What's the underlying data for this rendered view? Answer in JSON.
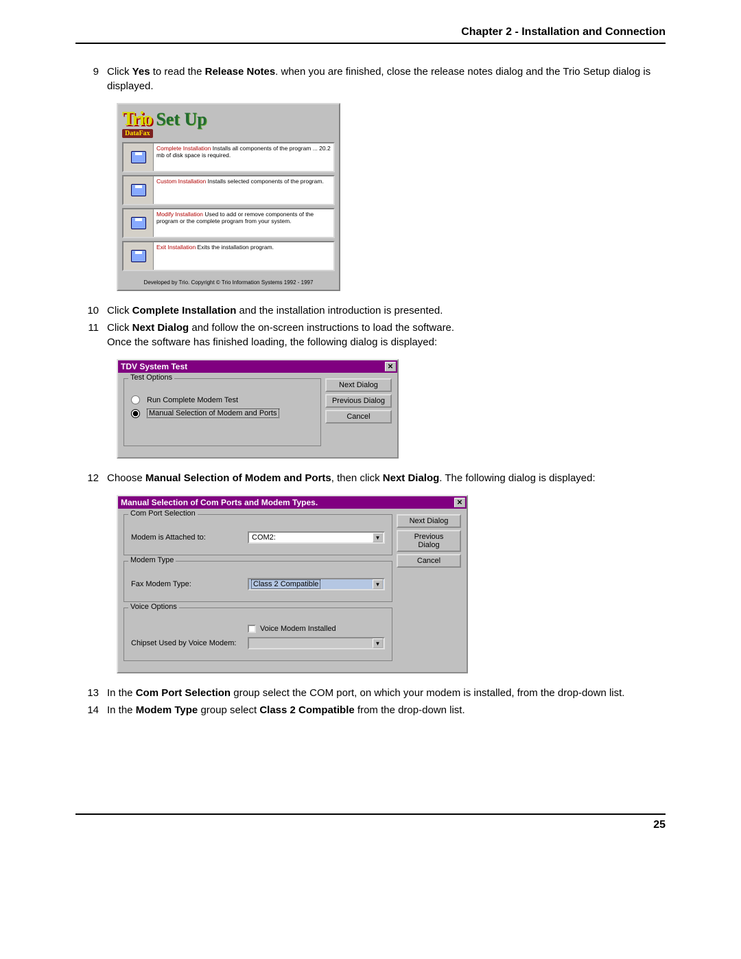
{
  "header": {
    "title": "Chapter 2 - Installation and Connection"
  },
  "steps": {
    "s9_pre": "Click ",
    "s9_b1": "Yes",
    "s9_mid": " to read the ",
    "s9_b2": "Release Notes",
    "s9_post": ". when you are finished, close the release notes dialog and the Trio Setup dialog is displayed.",
    "s10_pre": "Click ",
    "s10_b": "Complete Installation",
    "s10_post": " and the installation introduction is presented.",
    "s11_pre": "Click ",
    "s11_b": "Next Dialog",
    "s11_post": " and follow the on-screen instructions to load the software.",
    "s11_line2": "Once the software has finished loading, the following dialog is displayed:",
    "s12_pre": "Choose ",
    "s12_b1": "Manual Selection of Modem and Ports",
    "s12_mid": ", then click ",
    "s12_b2": "Next Dialog",
    "s12_post": ". The following dialog is displayed:",
    "s13_pre": "In the ",
    "s13_b": "Com Port Selection",
    "s13_post": " group select the COM port, on which your modem is installed, from the drop-down list.",
    "s14_pre": "In the ",
    "s14_b1": "Modem Type",
    "s14_mid": " group select ",
    "s14_b2": "Class 2 Compatible",
    "s14_post": " from the drop-down list."
  },
  "step_numbers": {
    "s9": "9",
    "s10": "10",
    "s11": "11",
    "s12": "12",
    "s13": "13",
    "s14": "14"
  },
  "trio": {
    "logo_main": "Trio",
    "logo_right": "Set Up",
    "datafax": "DataFax",
    "options": [
      {
        "title": "Complete Installation ",
        "desc": "Installs all components of the program ... 20.2 mb of disk space is required."
      },
      {
        "title": "Custom Installation ",
        "desc": "Installs selected components of the program."
      },
      {
        "title": "Modify Installation ",
        "desc": "Used to add or remove components of the program or the complete program from your system."
      },
      {
        "title": "Exit Installation ",
        "desc": "Exits the installation program."
      }
    ],
    "footer": "Developed by Trio. Copyright © Trio Information Systems 1992 - 1997"
  },
  "tdv": {
    "title": "TDV System Test",
    "group": "Test Options",
    "opt1": "Run Complete Modem Test",
    "opt2": "Manual Selection of Modem and Ports",
    "btn_next": "Next Dialog",
    "btn_prev": "Previous Dialog",
    "btn_cancel": "Cancel"
  },
  "manual": {
    "title": "Manual Selection of Com Ports and Modem Types.",
    "g1": "Com Port Selection",
    "g1_label": "Modem is Attached to:",
    "g1_value": "COM2:",
    "g2": "Modem Type",
    "g2_label": "Fax Modem Type:",
    "g2_value": "Class 2 Compatible",
    "g3": "Voice Options",
    "g3_check": "Voice Modem Installed",
    "g3_label2": "Chipset Used by Voice Modem:",
    "g3_value2": "",
    "btn_next": "Next Dialog",
    "btn_prev": "Previous Dialog",
    "btn_cancel": "Cancel"
  },
  "page_number": "25"
}
